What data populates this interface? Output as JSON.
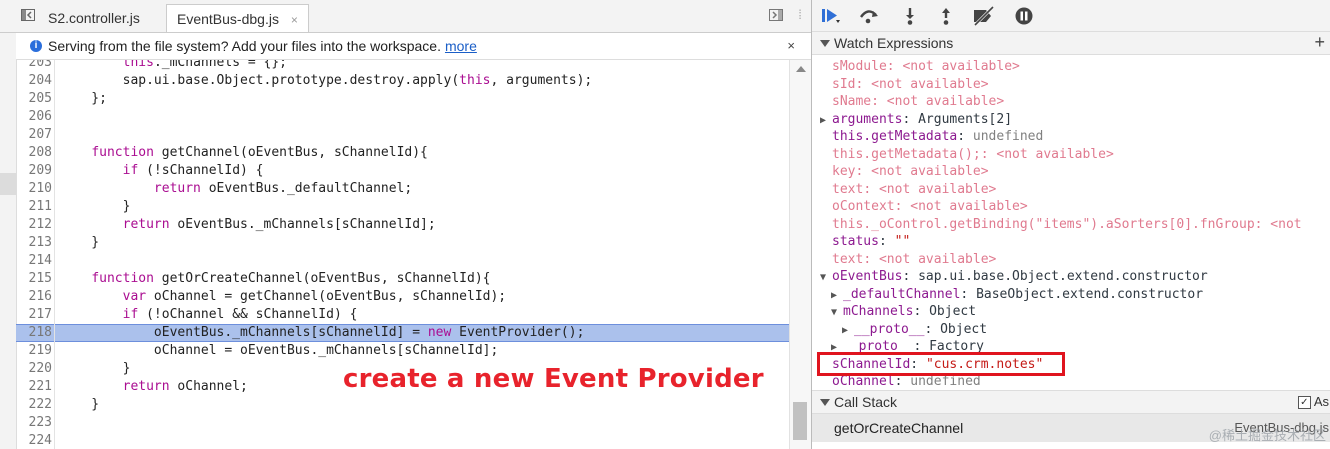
{
  "tabs": [
    {
      "label": "S2.controller.js",
      "active": false
    },
    {
      "label": "EventBus-dbg.js",
      "active": true
    }
  ],
  "tab_close_glyph": "×",
  "infobar": {
    "text": "Serving from the file system? Add your files into the workspace.",
    "link": "more",
    "close": "×"
  },
  "code_lines": [
    {
      "n": "203",
      "t": "        this._mChannels = {};",
      "hl": false
    },
    {
      "n": "204",
      "t": "        sap.ui.base.Object.prototype.destroy.apply(this, arguments);",
      "hl": false
    },
    {
      "n": "205",
      "t": "    };",
      "hl": false
    },
    {
      "n": "206",
      "t": "",
      "hl": false
    },
    {
      "n": "207",
      "t": "",
      "hl": false
    },
    {
      "n": "208",
      "t": "    function getChannel(oEventBus, sChannelId){",
      "hl": false
    },
    {
      "n": "209",
      "t": "        if (!sChannelId) {",
      "hl": false
    },
    {
      "n": "210",
      "t": "            return oEventBus._defaultChannel;",
      "hl": false
    },
    {
      "n": "211",
      "t": "        }",
      "hl": false
    },
    {
      "n": "212",
      "t": "        return oEventBus._mChannels[sChannelId];",
      "hl": false
    },
    {
      "n": "213",
      "t": "    }",
      "hl": false
    },
    {
      "n": "214",
      "t": "",
      "hl": false
    },
    {
      "n": "215",
      "t": "    function getOrCreateChannel(oEventBus, sChannelId){",
      "hl": false
    },
    {
      "n": "216",
      "t": "        var oChannel = getChannel(oEventBus, sChannelId);",
      "hl": false
    },
    {
      "n": "217",
      "t": "        if (!oChannel && sChannelId) {",
      "hl": false
    },
    {
      "n": "218",
      "t": "            oEventBus._mChannels[sChannelId] = new EventProvider();",
      "hl": true
    },
    {
      "n": "219",
      "t": "            oChannel = oEventBus._mChannels[sChannelId];",
      "hl": false
    },
    {
      "n": "220",
      "t": "        }",
      "hl": false
    },
    {
      "n": "221",
      "t": "        return oChannel;",
      "hl": false
    },
    {
      "n": "222",
      "t": "    }",
      "hl": false
    },
    {
      "n": "223",
      "t": "",
      "hl": false
    },
    {
      "n": "224",
      "t": "",
      "hl": false
    }
  ],
  "annotation": "create a new Event Provider",
  "watch": {
    "title": "Watch Expressions",
    "add": "+",
    "items": [
      {
        "key": "sModule",
        "sep": ": ",
        "val": "<not available>",
        "kind": "na",
        "indent": 0
      },
      {
        "key": "sId",
        "sep": ": ",
        "val": "<not available>",
        "kind": "na",
        "indent": 0
      },
      {
        "key": "sName",
        "sep": ": ",
        "val": "<not available>",
        "kind": "na",
        "indent": 0
      },
      {
        "key": "arguments",
        "sep": ": ",
        "val": "Arguments[2]",
        "kind": "obj",
        "indent": 0,
        "arrow": "▶"
      },
      {
        "key": "this.getMetadata",
        "sep": ": ",
        "val": "undefined",
        "kind": "und",
        "indent": 0
      },
      {
        "key": "this.getMetadata();",
        "sep": ": ",
        "val": "<not available>",
        "kind": "na",
        "indent": 0
      },
      {
        "key": "key",
        "sep": ": ",
        "val": "<not available>",
        "kind": "na",
        "indent": 0
      },
      {
        "key": "text",
        "sep": ": ",
        "val": "<not available>",
        "kind": "na",
        "indent": 0
      },
      {
        "key": "oContext",
        "sep": ": ",
        "val": "<not available>",
        "kind": "na",
        "indent": 0
      },
      {
        "key": "this._oControl.getBinding(\"items\").aSorters[0].fnGroup",
        "sep": ": ",
        "val": "<not",
        "kind": "na",
        "indent": 0
      },
      {
        "key": "status",
        "sep": ": ",
        "val": "\"\"",
        "kind": "str",
        "indent": 0
      },
      {
        "key": "text",
        "sep": ": ",
        "val": "<not available>",
        "kind": "na",
        "indent": 0
      },
      {
        "key": "oEventBus",
        "sep": ": ",
        "val": "sap.ui.base.Object.extend.constructor",
        "kind": "obj",
        "indent": 0,
        "arrow": "▼"
      },
      {
        "key": "_defaultChannel",
        "sep": ": ",
        "val": "BaseObject.extend.constructor",
        "kind": "obj",
        "indent": 1,
        "arrow": "▶"
      },
      {
        "key": "mChannels",
        "sep": ": ",
        "val": "Object",
        "kind": "obj",
        "indent": 1,
        "arrow": "▼"
      },
      {
        "key": "__proto__",
        "sep": ": ",
        "val": "Object",
        "kind": "obj",
        "indent": 2,
        "arrow": "▶"
      },
      {
        "key": "__proto__",
        "sep": ": ",
        "val": "Factory",
        "kind": "obj",
        "indent": 1,
        "arrow": "▶"
      },
      {
        "key": "sChannelId",
        "sep": ": ",
        "val": "\"cus.crm.notes\"",
        "kind": "str",
        "indent": 0
      },
      {
        "key": "oChannel",
        "sep": ": ",
        "val": "undefined",
        "kind": "und",
        "indent": 0
      }
    ]
  },
  "callstack": {
    "title": "Call Stack",
    "async_label": "As",
    "async_checked": "✓",
    "frame_fn": "getOrCreateChannel",
    "frame_file": "EventBus-dbg.js"
  },
  "watermark": "@稀土掘金技术社区"
}
